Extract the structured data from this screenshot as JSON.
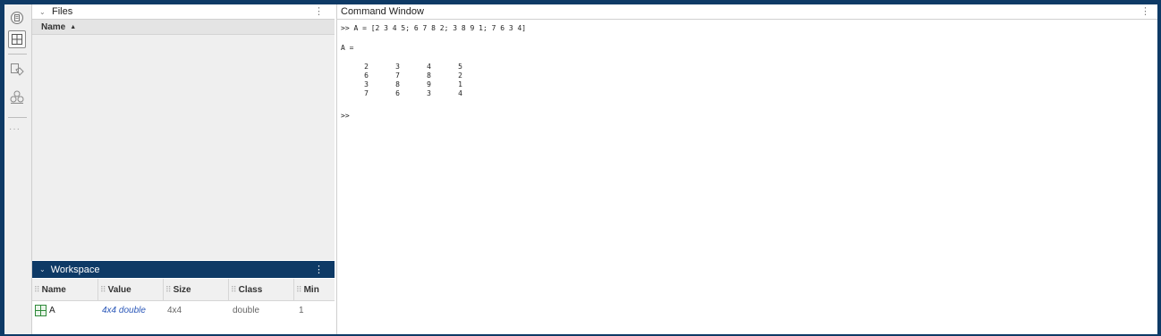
{
  "files": {
    "title": "Files",
    "column_name": "Name"
  },
  "workspace": {
    "title": "Workspace",
    "columns": [
      "Name",
      "Value",
      "Size",
      "Class",
      "Min"
    ],
    "rows": [
      {
        "name": "A",
        "value": "4x4 double",
        "size": "4x4",
        "class": "double",
        "min": "1"
      }
    ]
  },
  "command_window": {
    "title": "Command Window",
    "command": ">> A = [2 3 4 5; 6 7 8 2; 3 8 9 1; 7 6 3 4]",
    "output_label": "A =",
    "matrix": [
      [
        "2",
        "3",
        "4",
        "5"
      ],
      [
        "6",
        "7",
        "8",
        "2"
      ],
      [
        "3",
        "8",
        "9",
        "1"
      ],
      [
        "7",
        "6",
        "3",
        "4"
      ]
    ],
    "prompt": ">>"
  },
  "icons": {
    "kebab": "⋮",
    "collapse": "⌄",
    "sort": "▲",
    "grip": "⠿",
    "more": "···"
  },
  "colors": {
    "accent": "#0e3a66",
    "value_link": "#2a57b8"
  }
}
